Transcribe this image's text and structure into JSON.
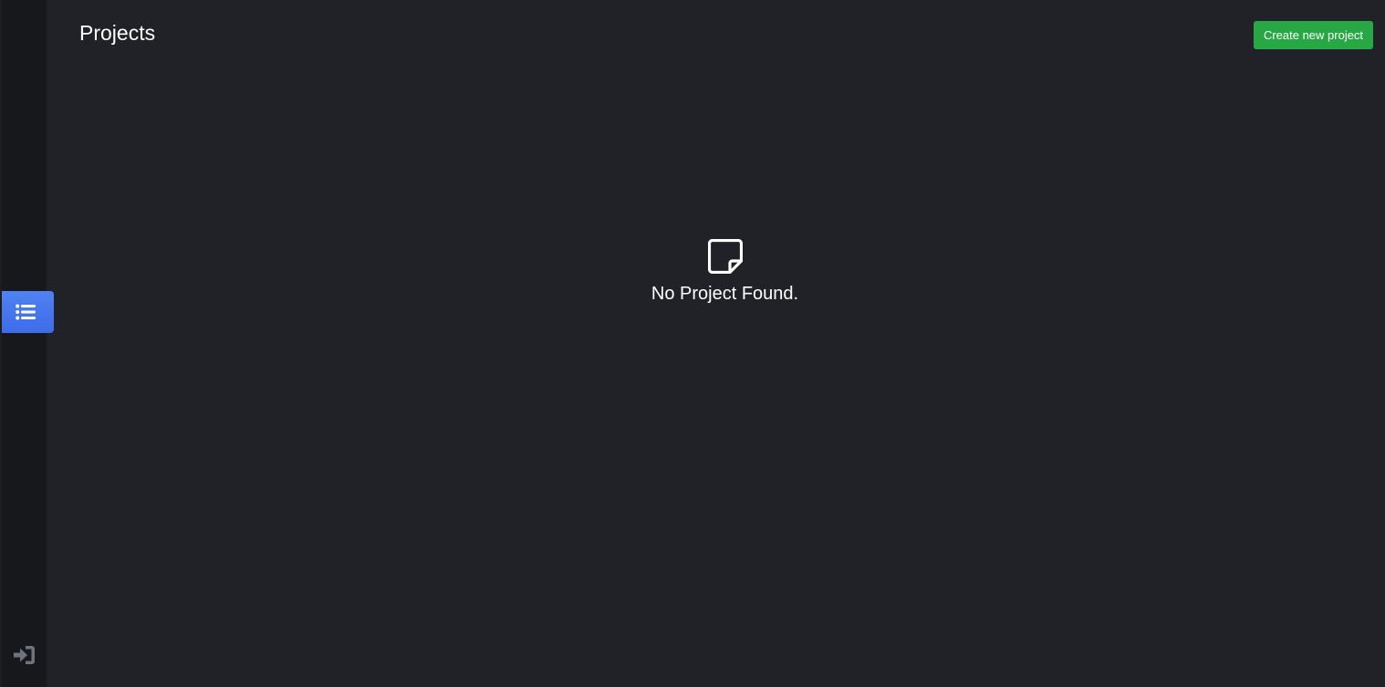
{
  "header": {
    "title": "Projects",
    "create_button_label": "Create new project"
  },
  "sidebar": {
    "items": [
      {
        "name": "projects",
        "icon": "list-icon",
        "active": true
      }
    ],
    "footer": {
      "icon": "sign-in-icon"
    }
  },
  "empty_state": {
    "icon": "sticky-note-icon",
    "message": "No Project Found."
  },
  "colors": {
    "background": "#202228",
    "sidebar": "#16181c",
    "active_nav": "#4a7bf0",
    "primary_button": "#28a745",
    "muted_icon": "#6c757d"
  }
}
